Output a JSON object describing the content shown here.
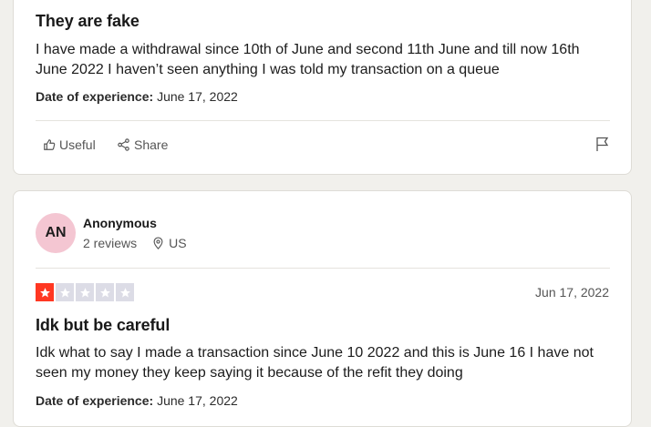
{
  "reviews": [
    {
      "title": "They are fake",
      "body": "I have made a withdrawal since 10th of June and second 11th June and till now 16th June 2022 I haven’t seen anything I was told my transaction on a queue",
      "experience_label": "Date of experience:",
      "experience_date": "June 17, 2022",
      "actions": {
        "useful": "Useful",
        "share": "Share"
      }
    },
    {
      "avatar_initials": "AN",
      "reviewer_name": "Anonymous",
      "reviewer_reviews": "2 reviews",
      "reviewer_country": "US",
      "rating": 1,
      "rating_max": 5,
      "date": "Jun 17, 2022",
      "title": "Idk but be careful",
      "body": "Idk what to say I made a transaction since June 10 2022 and this is June 16 I have not seen my money they keep saying it because of the refit they doing",
      "experience_label": "Date of experience:",
      "experience_date": "June 17, 2022"
    }
  ],
  "colors": {
    "star_filled": "#ff3722",
    "star_empty": "#dcdce6",
    "avatar_bg": "#f4c6d2"
  },
  "icons": [
    "thumbs-up-icon",
    "share-icon",
    "flag-icon",
    "location-pin-icon",
    "star-icon"
  ]
}
